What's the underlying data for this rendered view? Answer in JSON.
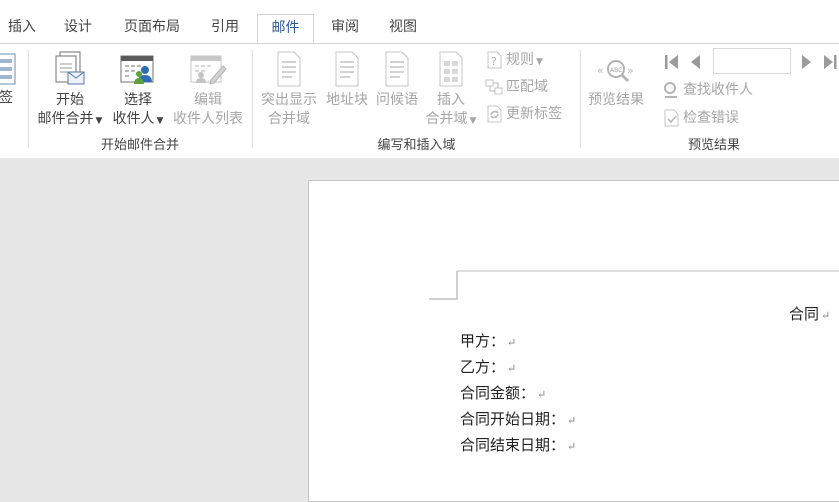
{
  "tabs": [
    "插入",
    "设计",
    "页面布局",
    "引用",
    "邮件",
    "审阅",
    "视图"
  ],
  "active_tab": "邮件",
  "ribbon": {
    "cutoff_label": "签",
    "start_merge": {
      "group_label": "开始邮件合并",
      "start_button": {
        "line1": "开始",
        "line2": "邮件合并"
      },
      "select_recipients": {
        "line1": "选择",
        "line2": "收件人"
      },
      "edit_recipients": {
        "line1": "编辑",
        "line2": "收件人列表"
      }
    },
    "write_insert": {
      "group_label": "编写和插入域",
      "highlight": {
        "line1": "突出显示",
        "line2": "合并域"
      },
      "address_block": "地址块",
      "greeting": "问候语",
      "insert_field": {
        "line1": "插入",
        "line2": "合并域"
      },
      "rules": "规则",
      "match_fields": "匹配域",
      "update_labels": "更新标签"
    },
    "preview": {
      "group_label": "预览结果",
      "preview_button": "预览结果",
      "find_recipient": "查找收件人",
      "check_errors": "检查错误",
      "record_value": ""
    }
  },
  "document": {
    "title_partial": "合同",
    "lines": [
      "甲方：",
      "乙方：",
      "合同金额：",
      "合同开始日期：",
      "合同结束日期："
    ],
    "paragraph_mark": "↵"
  }
}
